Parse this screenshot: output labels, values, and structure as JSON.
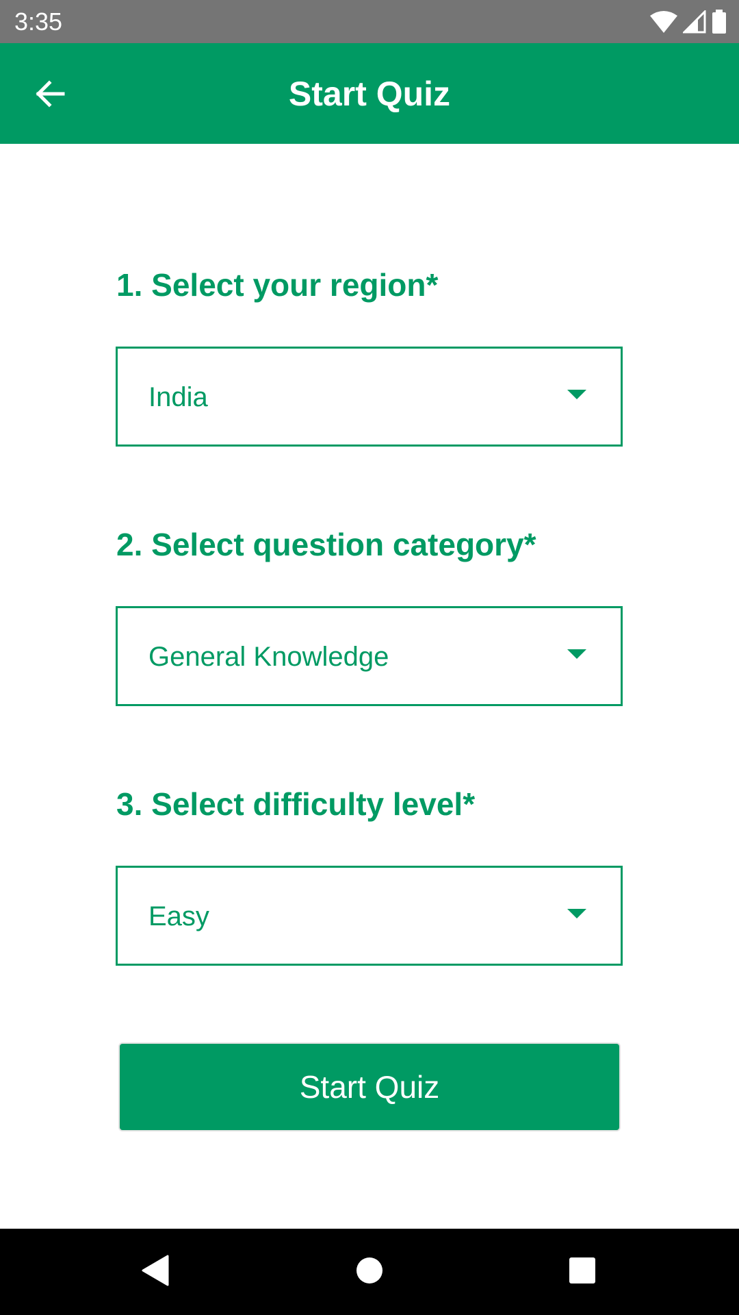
{
  "status_bar": {
    "time": "3:35",
    "icons": [
      "wifi-icon",
      "cell-signal-icon",
      "battery-icon"
    ]
  },
  "app_bar": {
    "title": "Start Quiz",
    "back_icon": "arrow-left-icon"
  },
  "form": {
    "region": {
      "label": "1. Select your region*",
      "value": "India"
    },
    "category": {
      "label": "2. Select question category*",
      "value": "General Knowledge"
    },
    "difficulty": {
      "label": "3. Select difficulty level*",
      "value": "Easy"
    },
    "submit_label": "Start Quiz"
  },
  "nav_bar": {
    "buttons": [
      "back-triangle-icon",
      "home-circle-icon",
      "recents-square-icon"
    ]
  },
  "colors": {
    "accent": "#009a63",
    "status_bar": "#757575",
    "nav_bar": "#000000",
    "background": "#ffffff"
  }
}
